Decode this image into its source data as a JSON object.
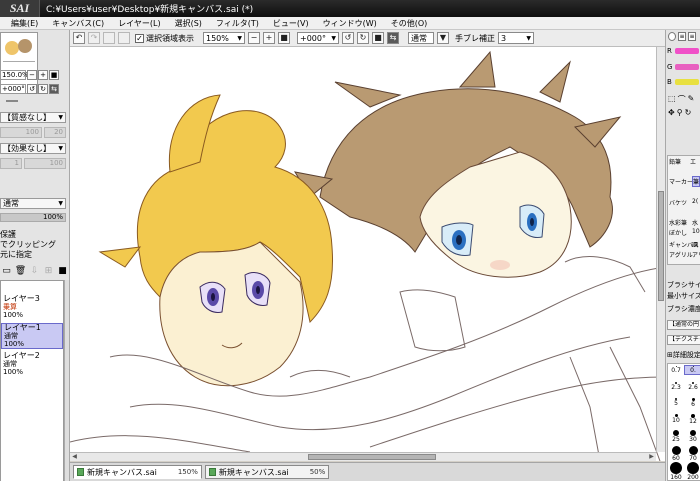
{
  "window": {
    "app_logo": "SAI",
    "title": "C:¥Users¥user¥Desktop¥新規キャンバス.sai (*)"
  },
  "menu": [
    "編集(E)",
    "キャンバス(C)",
    "レイヤー(L)",
    "選択(S)",
    "フィルタ(T)",
    "ビュー(V)",
    "ウィンドウ(W)",
    "その他(O)"
  ],
  "toolbar": {
    "show_selection_label": "選択領域表示",
    "show_selection_checked": "✓",
    "zoom": "150%",
    "rotation": "+000°",
    "blend_mode": "通常",
    "stabilizer_label": "手ブレ補正",
    "stabilizer_value": "3"
  },
  "left_panel": {
    "zoom": "150.0%",
    "rotation": "+000°",
    "paper_texture": "【質感なし】",
    "paper_texture_value": "20",
    "paper_texture_strength": "100",
    "effect": "【効果なし】",
    "effect_value": "1",
    "effect_strength": "100",
    "layer_mode": "通常",
    "opacity": "100%",
    "opacity_value": 100,
    "option_1": "保護",
    "option_2": "でクリッピング",
    "option_3": "元に指定",
    "layers": [
      {
        "name": "レイヤー3",
        "mode": "乗算",
        "opacity": "100%",
        "selected": false
      },
      {
        "name": "レイヤー1",
        "mode": "通常",
        "opacity": "100%",
        "selected": true
      },
      {
        "name": "レイヤー2",
        "mode": "通常",
        "opacity": "100%",
        "selected": false
      }
    ]
  },
  "tabs": [
    {
      "name": "新規キャンバス.sai",
      "zoom": "150%",
      "active": true
    },
    {
      "name": "新規キャンバス.sai",
      "zoom": "50%",
      "active": false
    }
  ],
  "right_panel": {
    "channels": [
      "R",
      "G",
      "B"
    ],
    "channel_colors": [
      "#f050c8",
      "#e860c0",
      "#e8e040"
    ],
    "tools": {
      "pencil": "鉛筆",
      "eraser": "エ",
      "marker": "マーカー",
      "airbrush": "筆",
      "bucket": "バケツ",
      "value": "2(",
      "watercolor": "水彩筆",
      "water": "水",
      "blur": "ぼかし",
      "value2": "10",
      "canvas_brush": "ギャンバス",
      "paint": "画",
      "unknown_a": "アグリル",
      "unknown_b": "アリ"
    },
    "brush_size_label": "ブラシサイズ",
    "min_size_label": "最小サイズ",
    "brush_density_label": "ブラシ濃度",
    "shape_label": "【通常の円",
    "texture_label": "【テクスチャ",
    "detail_label": "詳細設定",
    "brush_sizes": [
      "0.7",
      "0.",
      "2.3",
      "2.6",
      "5",
      "6",
      "10",
      "12",
      "25",
      "30",
      "60",
      "70",
      "160",
      "200"
    ]
  }
}
